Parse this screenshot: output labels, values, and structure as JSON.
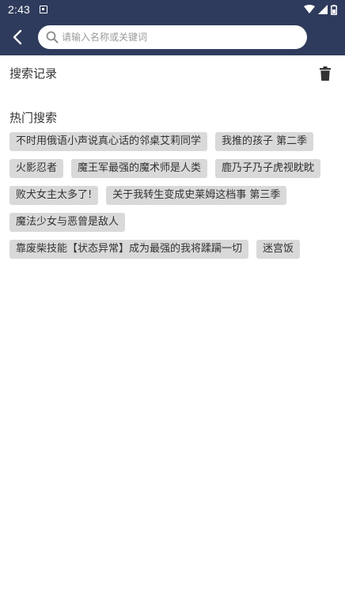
{
  "status_bar": {
    "time": "2:43",
    "icons": [
      "notification-icon",
      "wifi-icon",
      "signal-icon",
      "battery-icon"
    ]
  },
  "header": {
    "back_icon": "back-arrow-icon",
    "search": {
      "placeholder": "请输入名称或关键词",
      "value": "",
      "icon": "search-icon"
    },
    "background_color": "#2f3b5c"
  },
  "history": {
    "title": "搜索记录",
    "clear_icon": "trash-icon"
  },
  "hot": {
    "title": "热门搜索",
    "tags": [
      "不时用俄语小声说真心话的邻桌艾莉同学",
      "我推的孩子 第二季",
      "火影忍者",
      "魔王军最强的魔术师是人类",
      "鹿乃子乃子虎视眈眈",
      "败犬女主太多了!",
      "关于我转生变成史莱姆这档事 第三季",
      "魔法少女与恶曾是敌人",
      "靠废柴技能【状态异常】成为最强的我将蹂躏一切",
      "迷宫饭"
    ]
  }
}
